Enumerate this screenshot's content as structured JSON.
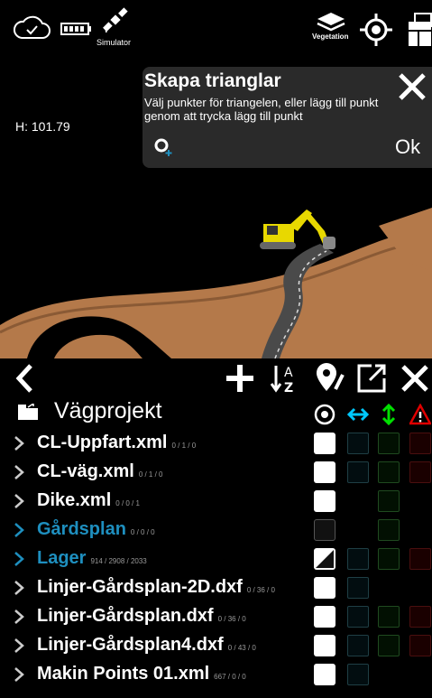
{
  "status_bar": {
    "simulator_label": "Simulator",
    "vegetation_label": "Vegetation"
  },
  "map": {
    "height_readout": "H: 101.79"
  },
  "dialog": {
    "title": "Skapa trianglar",
    "text": "Välj punkter för triangelen, eller lägg till punkt genom att trycka lägg till punkt",
    "ok_label": "Ok"
  },
  "panel": {
    "title": "Vägprojekt",
    "rows": [
      {
        "name": "CL-Uppfart.xml",
        "counts": "0 / 1 / 0"
      },
      {
        "name": "CL-väg.xml",
        "counts": "0 / 1 / 0"
      },
      {
        "name": "Dike.xml",
        "counts": "0 / 0 / 1"
      },
      {
        "name": "Gårdsplan",
        "counts": "0 / 0 / 0"
      },
      {
        "name": "Lager",
        "counts": "914 / 2908 / 2033"
      },
      {
        "name": "Linjer-Gårdsplan-2D.dxf",
        "counts": "0 / 36 / 0"
      },
      {
        "name": "Linjer-Gårdsplan.dxf",
        "counts": "0 / 36 / 0"
      },
      {
        "name": "Linjer-Gårdsplan4.dxf",
        "counts": "0 / 43 / 0"
      },
      {
        "name": "Makin Points 01.xml",
        "counts": "667 / 0 / 0"
      }
    ]
  },
  "colors": {
    "accent_blue": "#1e8fbf",
    "column_cyan": "#00c8ff",
    "column_green": "#00e000",
    "warning_red": "#e00000"
  }
}
